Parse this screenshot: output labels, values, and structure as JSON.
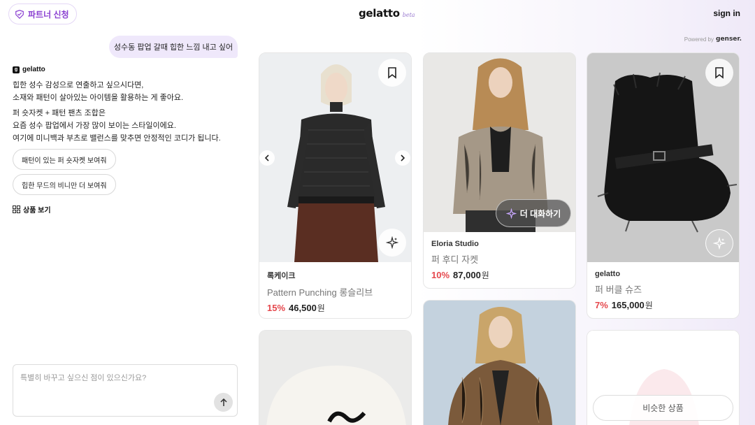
{
  "header": {
    "partner_label": "파트너 신청",
    "logo": "gelatto",
    "logo_beta": "beta",
    "signin": "sign in"
  },
  "powered": {
    "label": "Powered by",
    "brand": "genser."
  },
  "chat": {
    "user_message": "성수동 팝업 갈때 힙한 느낌 내고 싶어",
    "bot_name": "gelatto",
    "bot_paragraphs": [
      [
        "힙한 성수 감성으로 연출하고 싶으시다면,",
        "소재와 패턴이 살아있는 아이템을 활용하는 게 좋아요."
      ],
      [
        "퍼 숏자켓 + 패턴 팬츠 조합은",
        "요즘 성수 팝업에서 가장 많이 보이는 스타일이에요.",
        "여기에 미니백과 부츠로 밸런스를 맞추면 안정적인 코디가 됩니다."
      ]
    ],
    "suggestions": [
      "패턴이 있는 퍼 숏자켓 보여줘",
      "힙한 무드의 비니만 더 보여줘"
    ],
    "view_products": "상품 보기",
    "input_placeholder": "특별히 바꾸고 싶으신 점이 있으신가요?"
  },
  "products": [
    {
      "brand": "록케이크",
      "name": "Pattern Punching 롱슬리브",
      "discount": "15%",
      "price": "46,500",
      "currency": "원"
    },
    {
      "brand": "Eloria Studio",
      "name": "퍼 후디 자켓",
      "discount": "10%",
      "price": "87,000",
      "currency": "원"
    },
    {
      "brand": "gelatto",
      "name": "퍼 버클 슈즈",
      "discount": "7%",
      "price": "165,000",
      "currency": "원"
    }
  ],
  "overlays": {
    "more_chat": "더 대화하기",
    "similar": "비슷한 상품"
  },
  "colors": {
    "accent": "#8a3fd1",
    "discount": "#e5484d",
    "user_bubble": "#efe8fb"
  }
}
